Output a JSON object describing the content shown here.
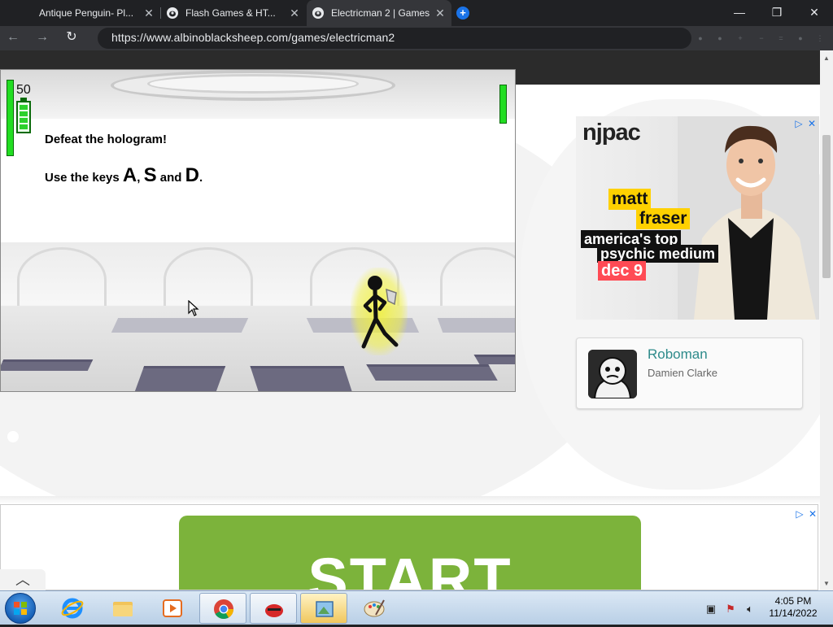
{
  "browser": {
    "tabs": [
      {
        "title": "Antique Penguin- Pl...",
        "active": false
      },
      {
        "title": "Flash Games & HT...",
        "active": false
      },
      {
        "title": "Electricman 2 | Games",
        "active": true
      }
    ],
    "new_tab_icon": "plus-icon",
    "url": "https://www.albinoblacksheep.com/games/electricman2",
    "window_controls": {
      "minimize": "—",
      "maximize": "❐",
      "close": "✕"
    }
  },
  "game": {
    "score": "50",
    "instruction_line1": "Defeat the hologram!",
    "instruction_prefix": "Use the keys ",
    "key_a": "A",
    "comma": ",",
    "key_s": "S",
    "and_word": " and ",
    "key_d": "D",
    "period": ".",
    "health_color": "#22dd22"
  },
  "ad": {
    "logo": "njpac",
    "name_line1": "matt",
    "name_line2": "fraser",
    "tagline_line1": "america's top",
    "tagline_line2": "psychic medium",
    "date": "dec 9",
    "accent_yellow": "#ffd100",
    "accent_red": "#ff4b55"
  },
  "related": {
    "title": "Roboman",
    "author": "Damien Clarke"
  },
  "bottom_ad": {
    "button_text": "START",
    "button_color": "#7cb33b"
  },
  "taskbar": {
    "time": "4:05 PM",
    "date": "11/14/2022"
  }
}
